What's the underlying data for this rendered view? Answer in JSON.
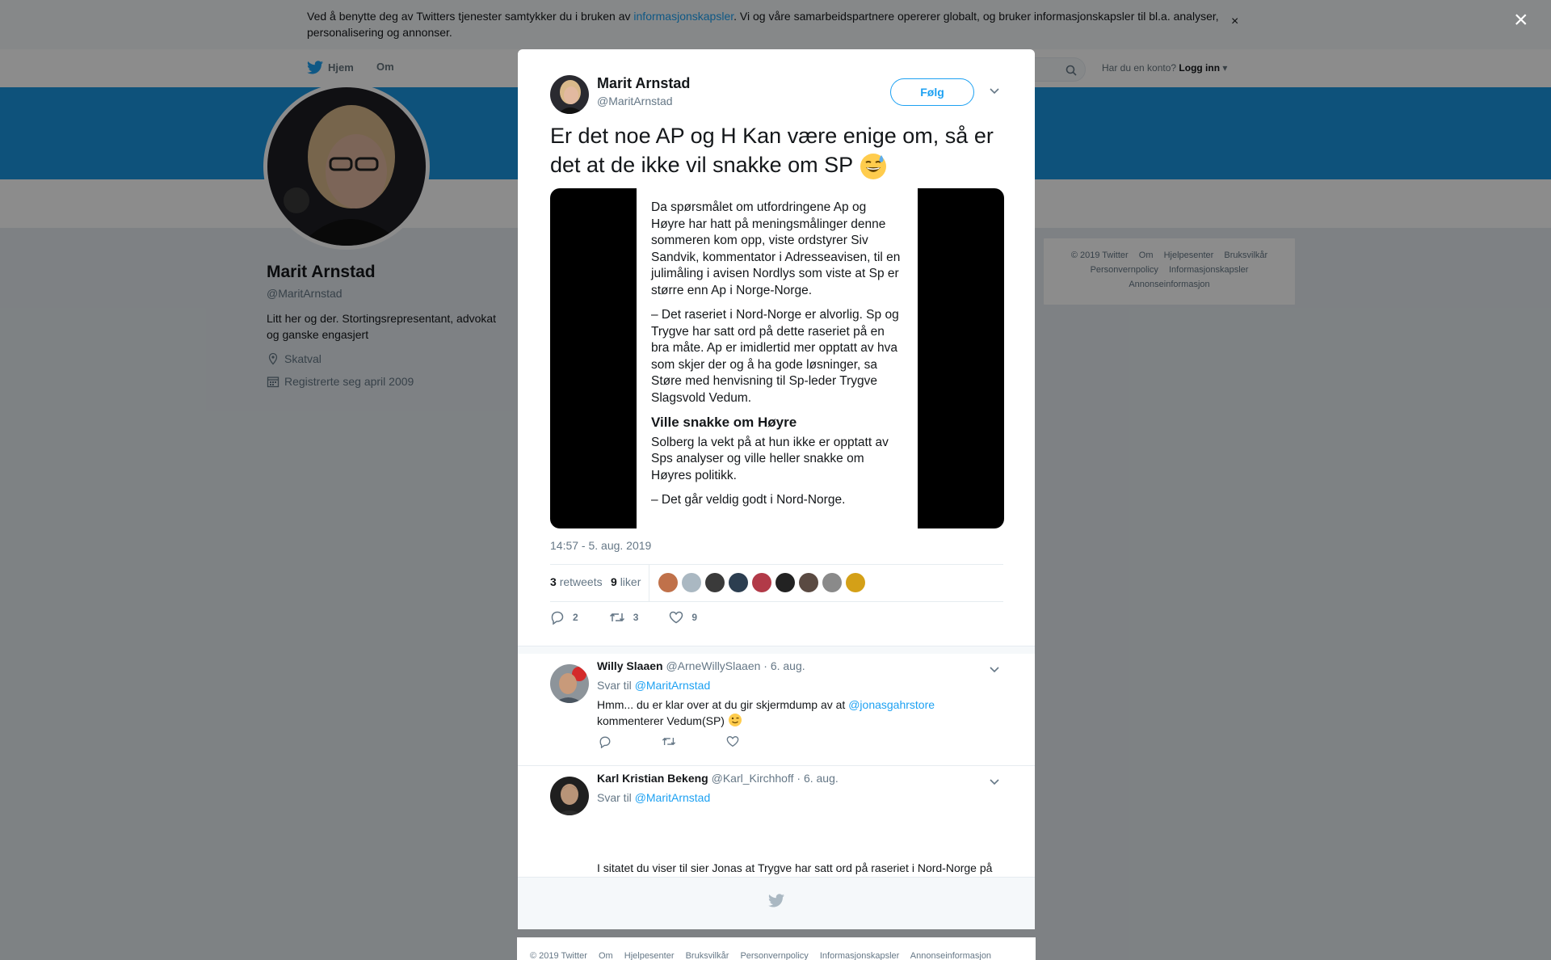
{
  "cookie": {
    "text_before": "Ved å benytte deg av Twitters tjenester samtykker du i bruken av ",
    "link": "informasjonskapsler",
    "text_after": ". Vi og våre samarbeidspartnere opererer globalt, og bruker informasjonskapsler til bl.a. analyser, personalisering og annonser.",
    "close": "×"
  },
  "nav": {
    "home": "Hjem",
    "about": "Om",
    "account_prompt": "Har du en konto?",
    "login": "Logg inn"
  },
  "profile": {
    "name": "Marit Arnstad",
    "handle": "@MaritArnstad",
    "bio": "Litt her og der. Stortingsrepresentant, advokat og ganske engasjert",
    "location": "Skatval",
    "joined": "Registrerte seg april 2009"
  },
  "right_footer": {
    "line1": [
      "© 2019 Twitter",
      "Om",
      "Hjelpesenter",
      "Bruksvilkår"
    ],
    "line2": [
      "Personvernpolicy",
      "Informasjonskapsler"
    ],
    "line3": [
      "Annonseinformasjon"
    ]
  },
  "overlay": {
    "close": "×"
  },
  "tweet": {
    "name": "Marit Arnstad",
    "handle": "@MaritArnstad",
    "follow": "Følg",
    "text": "Er det noe AP og H Kan være enige om, så er det at de ikke vil snakke om SP",
    "emoji": "sweat-smile-emoji",
    "media": {
      "p1": "Da spørsmålet om utfordringene Ap og Høyre har hatt på meningsmålinger denne sommeren kom opp, viste ordstyrer Siv Sandvik, kommentator i Adresseavisen, til en julimåling i avisen Nordlys som viste at Sp er større enn Ap i Norge-Norge.",
      "p2": "– Det raseriet i Nord-Norge er alvorlig. Sp og Trygve har satt ord på dette raseriet på en bra måte. Ap er imidlertid mer opptatt av hva som skjer der og å ha gode løsninger, sa Støre med henvisning til Sp-leder Trygve Slagsvold Vedum.",
      "heading": "Ville snakke om Høyre",
      "p3": "Solberg la vekt på at hun ikke er opptatt av Sps analyser og ville heller snakke om Høyres politikk.",
      "p4": "– Det går veldig godt i Nord-Norge."
    },
    "time": "14:57 - 5. aug. 2019",
    "retweets_count": "3",
    "retweets_label": "retweets",
    "likes_count": "9",
    "likes_label": "liker",
    "likers": [
      "#c0714a",
      "#aab8c2",
      "#3a3a3a",
      "#2c3e50",
      "#b23a48",
      "#222222",
      "#5a4a42",
      "#8a8a8a",
      "#d4a017"
    ],
    "actions": {
      "replies": "2",
      "retweets": "3",
      "likes": "9"
    }
  },
  "replies": [
    {
      "name": "Willy Slaaen",
      "handle": "@ArneWillySlaaen",
      "date": "· 6. aug.",
      "reply_to_label": "Svar til",
      "reply_to": "@MaritArnstad",
      "text_before": "Hmm... du er klar over at du gir skjermdump av at ",
      "mention": "@jonasgahrstore",
      "text_after": "kommenterer Vedum(SP)",
      "emoji": "winking-face-emoji"
    },
    {
      "name": "Karl Kristian Bekeng",
      "handle": "@Karl_Kirchhoff",
      "date": "· 6. aug.",
      "reply_to_label": "Svar til",
      "reply_to": "@MaritArnstad",
      "text": "I sitatet du viser til sier Jonas at Trygve har satt ord på raseriet i Nord-Norge på en god måte..."
    }
  ],
  "bottom_footer": [
    "© 2019 Twitter",
    "Om",
    "Hjelpesenter",
    "Bruksvilkår",
    "Personvernpolicy",
    "Informasjonskapsler",
    "Annonseinformasjon"
  ],
  "colors": {
    "accent": "#1da1f2",
    "banner": "#1b95e0",
    "muted": "#657786"
  }
}
